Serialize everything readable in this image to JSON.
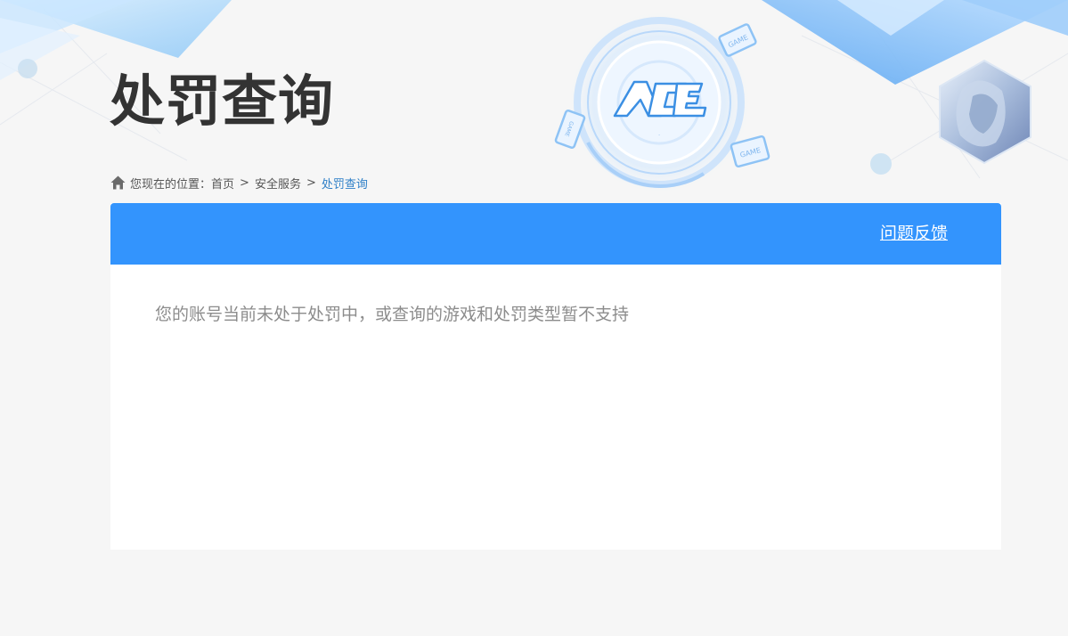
{
  "header": {
    "title": "处罚查询",
    "logo_text": "ACE",
    "device_badge_text": "GAME"
  },
  "breadcrumb": {
    "prefix": "您现在的位置：",
    "items": [
      "首页",
      "安全服务",
      "处罚查询"
    ],
    "separator": ">"
  },
  "panel": {
    "feedback_label": "问题反馈",
    "message": "您的账号当前未处于处罚中，或查询的游戏和处罚类型暂不支持"
  },
  "colors": {
    "accent": "#3394fd",
    "background": "#f6f6f6",
    "title_text": "#333333",
    "message_text": "#8c8c8c",
    "current_crumb": "#2e7fc7"
  }
}
